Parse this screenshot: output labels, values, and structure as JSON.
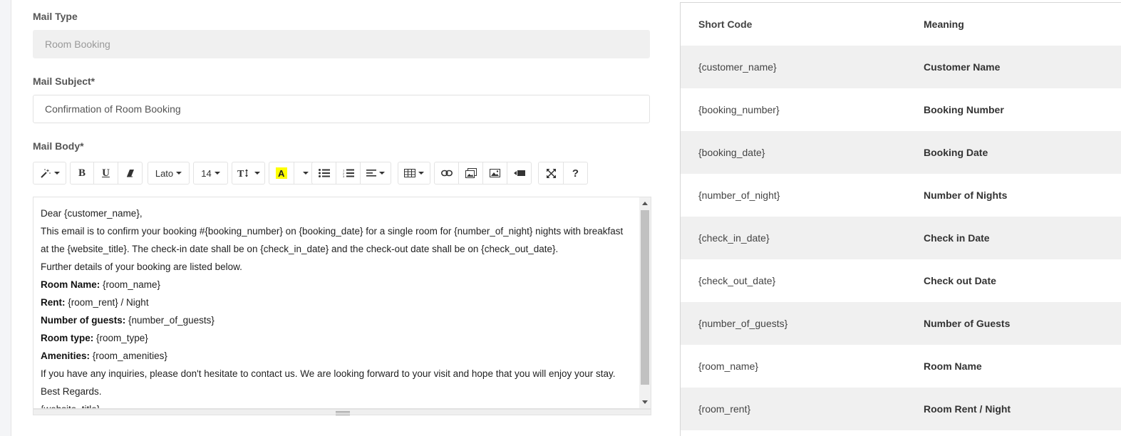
{
  "form": {
    "mail_type": {
      "label": "Mail Type",
      "value": "Room Booking"
    },
    "mail_subject": {
      "label": "Mail Subject*",
      "value": "Confirmation of Room Booking"
    },
    "mail_body": {
      "label": "Mail Body*"
    }
  },
  "toolbar": {
    "font_name": "Lato",
    "font_size": "14",
    "bold": "B",
    "underline": "U",
    "help": "?"
  },
  "editor": {
    "line1": "Dear {customer_name},",
    "line2": "This email is to confirm your booking #{booking_number} on {booking_date} for a single room for {number_of_night} nights with breakfast",
    "line3": "at the {website_title}. The check-in date shall be on {check_in_date} and the check-out date shall be on {check_out_date}.",
    "line4": "Further details of your booking are listed below.",
    "room_name_label": "Room Name:",
    "room_name_value": " {room_name}",
    "rent_label": "Rent:",
    "rent_value": " {room_rent} / Night",
    "guests_label": "Number of guests:",
    "guests_value": " {number_of_guests}",
    "room_type_label": "Room type:",
    "room_type_value": " {room_type}",
    "amenities_label": "Amenities:",
    "amenities_value": " {room_amenities}",
    "line10": "If you have any inquiries, please don't hesitate to contact us. We are looking forward to your visit and hope that you will enjoy your stay.",
    "line11": "Best Regards.",
    "line12": "{website_title}"
  },
  "short_codes": {
    "headers": {
      "code": "Short Code",
      "meaning": "Meaning"
    },
    "rows": [
      {
        "code": "{customer_name}",
        "meaning": "Customer Name"
      },
      {
        "code": "{booking_number}",
        "meaning": "Booking Number"
      },
      {
        "code": "{booking_date}",
        "meaning": "Booking Date"
      },
      {
        "code": "{number_of_night}",
        "meaning": "Number of Nights"
      },
      {
        "code": "{check_in_date}",
        "meaning": "Check in Date"
      },
      {
        "code": "{check_out_date}",
        "meaning": "Check out Date"
      },
      {
        "code": "{number_of_guests}",
        "meaning": "Number of Guests"
      },
      {
        "code": "{room_name}",
        "meaning": "Room Name"
      },
      {
        "code": "{room_rent}",
        "meaning": "Room Rent / Night"
      }
    ]
  },
  "colors": {
    "highlight": "#ffff00",
    "row_alt": "#f0f0f0"
  }
}
